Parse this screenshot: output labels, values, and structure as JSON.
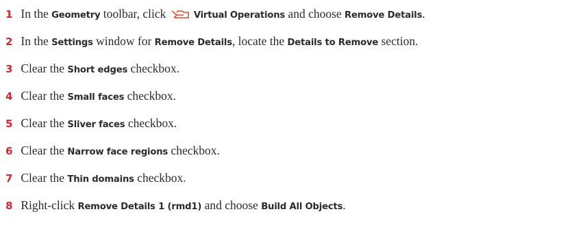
{
  "steps": [
    {
      "number": "1",
      "parts": [
        {
          "text": "In the ",
          "bold": false
        },
        {
          "text": "Geometry",
          "bold": true
        },
        {
          "text": " toolbar, click ",
          "bold": false
        },
        {
          "icon": "virtual-operations-icon"
        },
        {
          "text": "Virtual Operations",
          "bold": true
        },
        {
          "text": " and choose ",
          "bold": false
        },
        {
          "text": "Remove Details",
          "bold": true
        },
        {
          "text": ".",
          "bold": false
        }
      ]
    },
    {
      "number": "2",
      "parts": [
        {
          "text": "In the ",
          "bold": false
        },
        {
          "text": "Settings",
          "bold": true
        },
        {
          "text": " window for ",
          "bold": false
        },
        {
          "text": "Remove Details",
          "bold": true
        },
        {
          "text": ", locate the ",
          "bold": false
        },
        {
          "text": "Details to Remove",
          "bold": true
        },
        {
          "text": " section.",
          "bold": false
        }
      ]
    },
    {
      "number": "3",
      "parts": [
        {
          "text": "Clear the ",
          "bold": false
        },
        {
          "text": "Short edges",
          "bold": true
        },
        {
          "text": " checkbox.",
          "bold": false
        }
      ]
    },
    {
      "number": "4",
      "parts": [
        {
          "text": "Clear the ",
          "bold": false
        },
        {
          "text": "Small faces",
          "bold": true
        },
        {
          "text": " checkbox.",
          "bold": false
        }
      ]
    },
    {
      "number": "5",
      "parts": [
        {
          "text": "Clear the ",
          "bold": false
        },
        {
          "text": "Sliver faces",
          "bold": true
        },
        {
          "text": " checkbox.",
          "bold": false
        }
      ]
    },
    {
      "number": "6",
      "parts": [
        {
          "text": "Clear the ",
          "bold": false
        },
        {
          "text": "Narrow face regions",
          "bold": true
        },
        {
          "text": " checkbox.",
          "bold": false
        }
      ]
    },
    {
      "number": "7",
      "parts": [
        {
          "text": "Clear the ",
          "bold": false
        },
        {
          "text": "Thin domains",
          "bold": true
        },
        {
          "text": " checkbox.",
          "bold": false
        }
      ]
    },
    {
      "number": "8",
      "parts": [
        {
          "text": "Right-click ",
          "bold": false
        },
        {
          "text": "Remove Details 1 (rmd1)",
          "bold": true
        },
        {
          "text": " and choose ",
          "bold": false
        },
        {
          "text": "Build All Objects",
          "bold": true
        },
        {
          "text": ".",
          "bold": false
        }
      ]
    }
  ],
  "colors": {
    "step_number": "#d8262e",
    "text": "#2b2b2b",
    "icon": "#e64a2e"
  }
}
